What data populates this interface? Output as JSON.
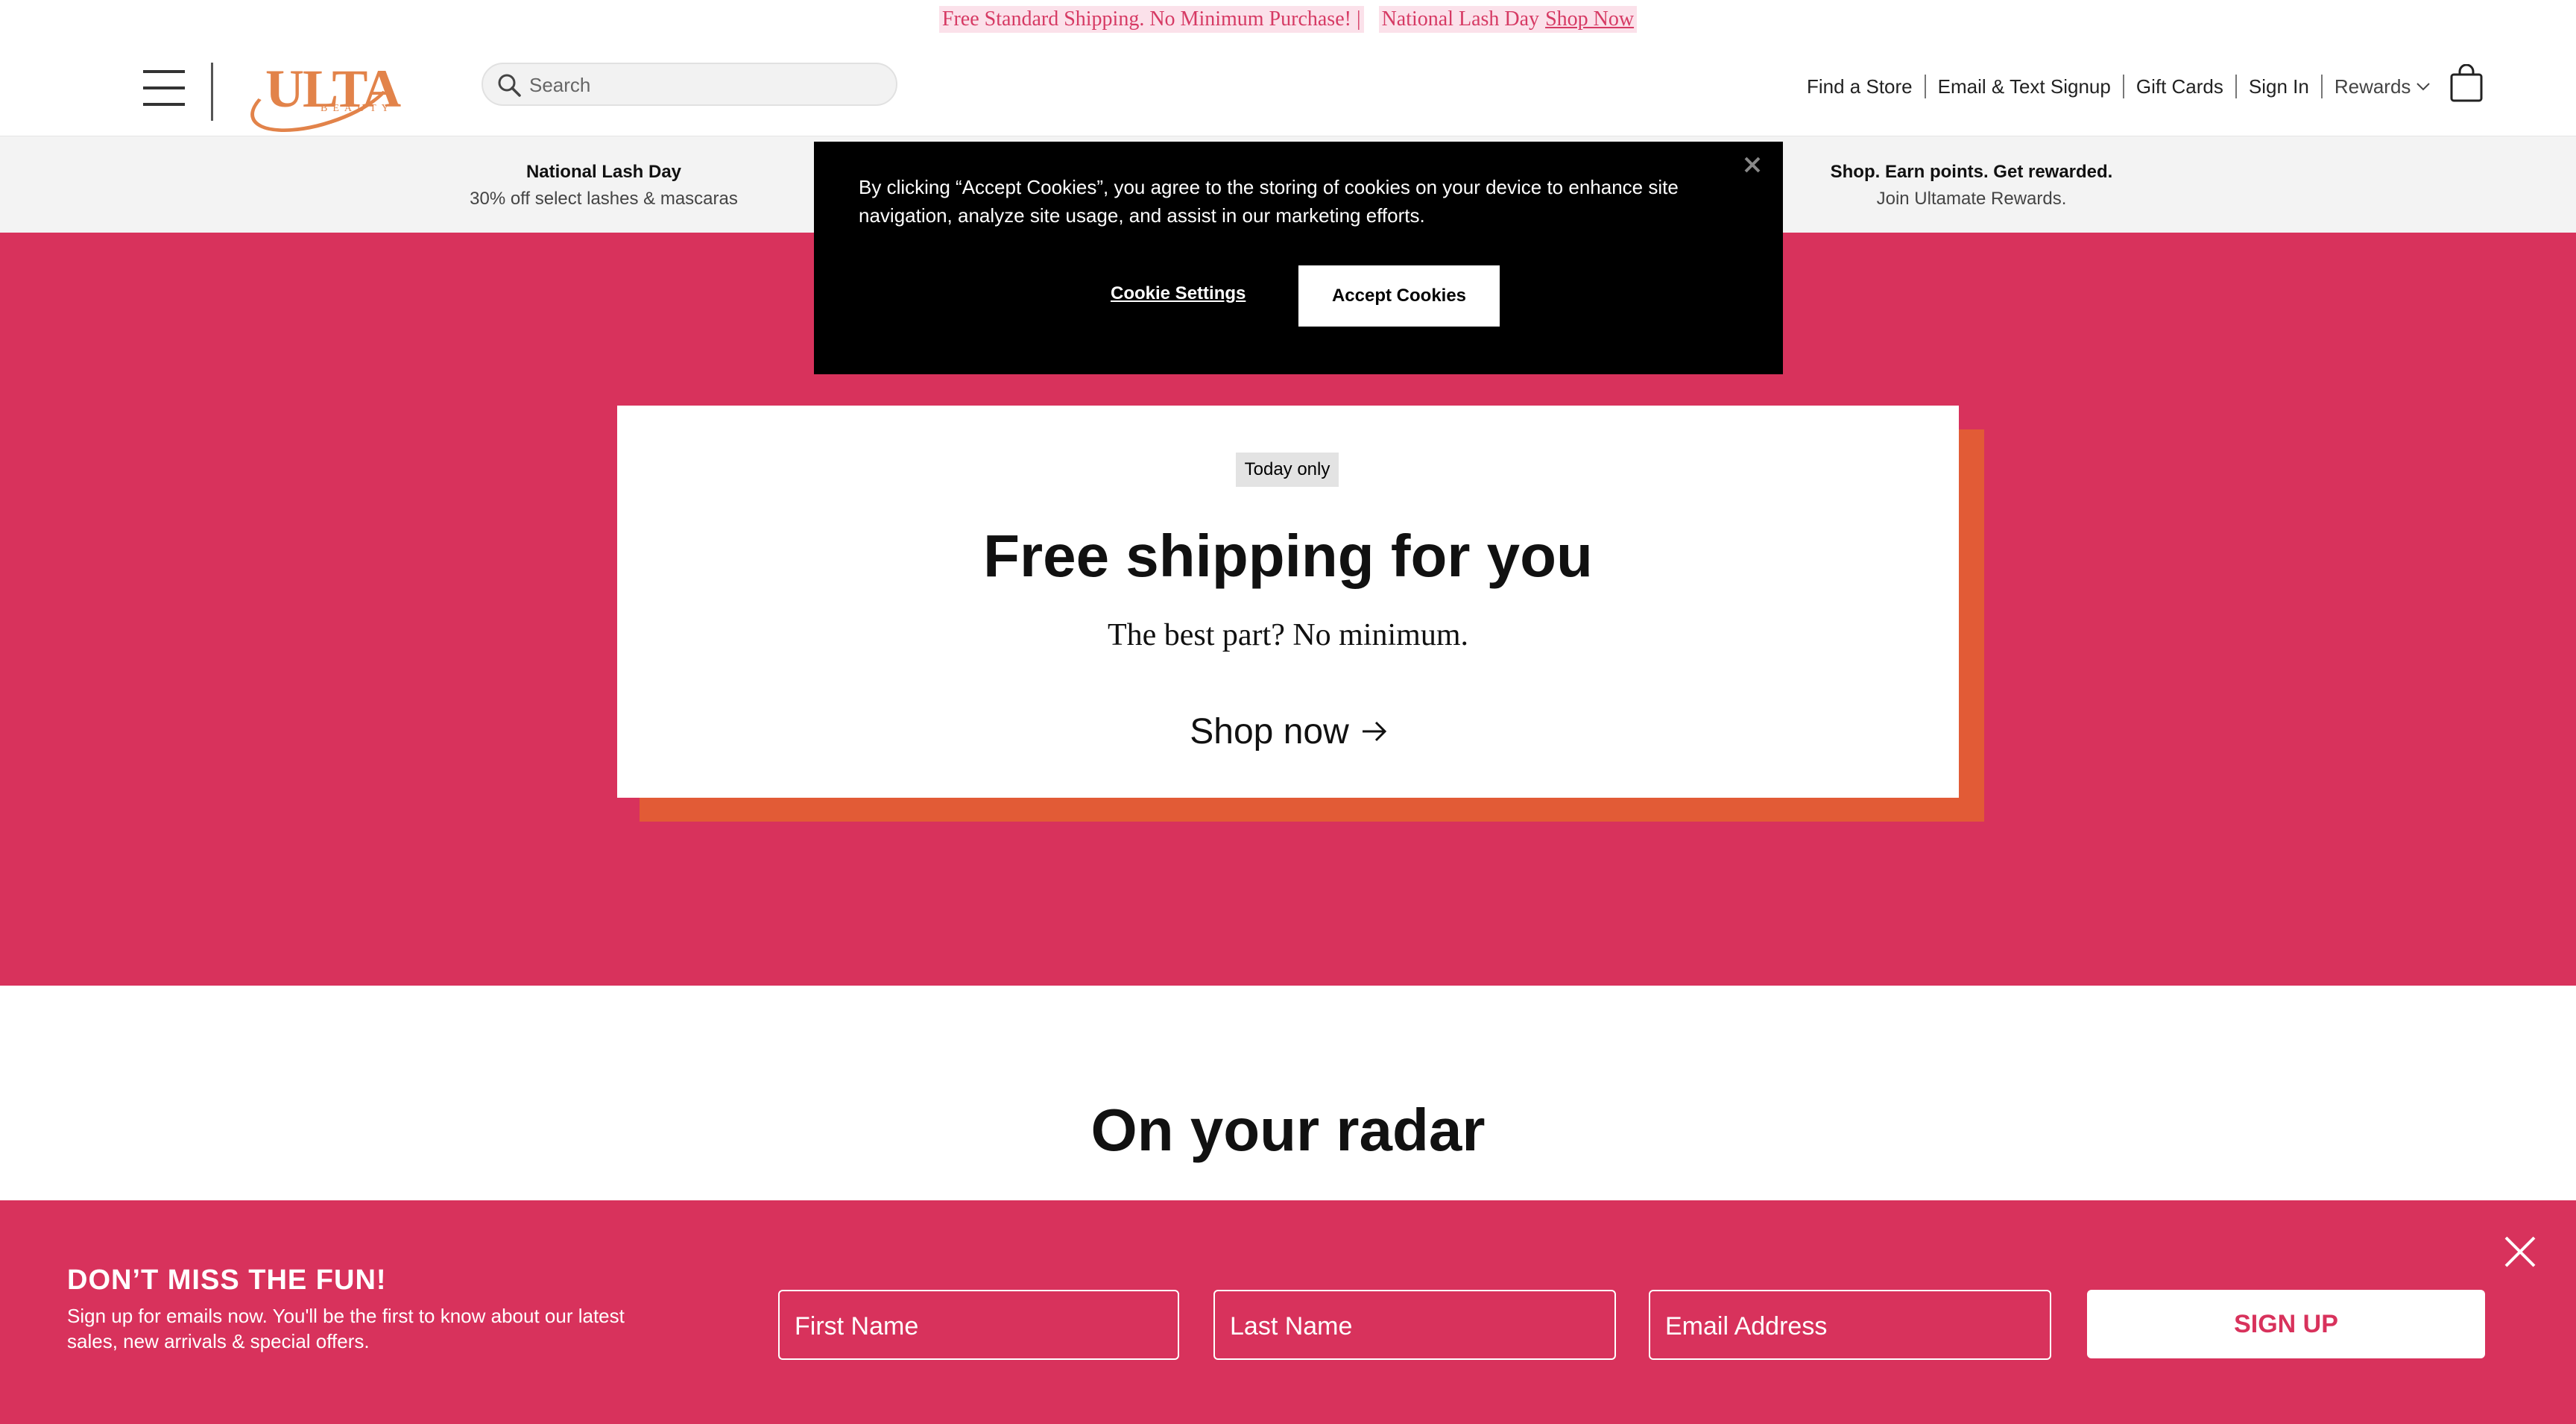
{
  "promo": {
    "text1": "Free Standard Shipping. No Minimum Purchase! |",
    "text2": "National Lash Day",
    "link": "Shop Now"
  },
  "header": {
    "logo_word": "ULTA",
    "logo_sub": "BEAUTY",
    "search_placeholder": "Search",
    "nav": [
      "Find a Store",
      "Email & Text Signup",
      "Gift Cards",
      "Sign In"
    ],
    "rewards": "Rewards"
  },
  "valuebar": {
    "left_title": "National Lash Day",
    "left_sub": "30% off select lashes & mascaras",
    "right_title": "Shop. Earn points. Get rewarded.",
    "right_sub": "Join Ultamate Rewards."
  },
  "hero": {
    "badge": "Today only",
    "title": "Free shipping for you",
    "subtitle": "The best part? No minimum.",
    "link": "Shop now"
  },
  "section": {
    "title": "On your radar"
  },
  "cookie": {
    "text": "By clicking “Accept Cookies”, you agree to the storing of cookies on your device to enhance site navigation, analyze site usage, and assist in our marketing efforts.",
    "settings": "Cookie Settings",
    "accept": "Accept Cookies"
  },
  "signup": {
    "heading": "DON’T MISS THE FUN!",
    "text": "Sign up for emails now. You'll be the first to know about our latest sales, new arrivals & special offers.",
    "first_name": "First Name",
    "last_name": "Last Name",
    "email": "Email Address",
    "button": "SIGN UP"
  },
  "colors": {
    "brand_pink": "#d8325c",
    "brand_orange": "#e2834a",
    "offset_orange": "#e25b36"
  }
}
